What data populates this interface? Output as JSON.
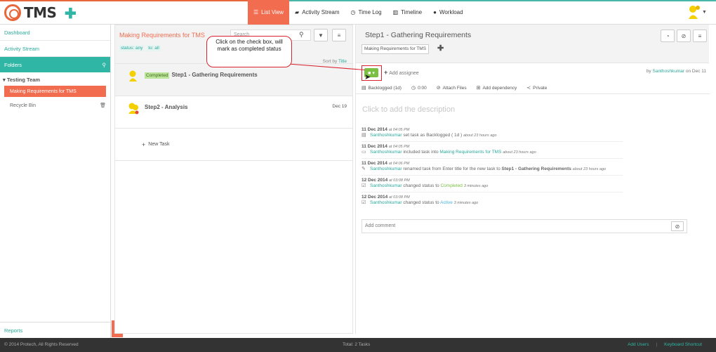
{
  "app": {
    "logo_text": "TMS"
  },
  "nav": {
    "tabs": [
      {
        "label": "List View",
        "icon": "list-icon"
      },
      {
        "label": "Activity Stream",
        "icon": "comment-icon"
      },
      {
        "label": "Time Log",
        "icon": "clock-icon"
      },
      {
        "label": "Timeline",
        "icon": "bars-icon"
      },
      {
        "label": "Workload",
        "icon": "user-icon"
      }
    ]
  },
  "sidebar": {
    "dashboard": "Dashboard",
    "activity_stream": "Activity Stream",
    "folders": "Folders",
    "team": "Testing Team",
    "active_folder": "Making Requirements for TMS",
    "recycle_bin": "Recycle Bin",
    "reports": "Reports"
  },
  "list": {
    "title": "Making Requirements for TMS",
    "filter_status": "status: any",
    "filter_to": "to: all",
    "search_placeholder": "Search",
    "sort_label": "Sort by",
    "sort_value": "Title",
    "tasks": [
      {
        "badge": "Completed",
        "name": "Step1 - Gathering Requirements",
        "date": ""
      },
      {
        "badge": "",
        "name": "Step2 - Analysis",
        "date": "Dec 19"
      }
    ],
    "new_task": "New Task"
  },
  "detail": {
    "title": "Step1 - Gathering Requirements",
    "folder_tag": "Making Requirements for TMS",
    "add_assignee": "Add assignee",
    "by_prefix": "by",
    "by_user": "Santhoshkumar",
    "by_date": "on Dec 11",
    "meta": {
      "backlogged": "Backlogged (1d)",
      "time": "0:00",
      "attach": "Attach Files",
      "dependency": "Add dependency",
      "private": "Private"
    },
    "description_placeholder": "Click to add the description",
    "timeline": [
      {
        "date": "11 Dec 2014",
        "time": "at 04:05 PM",
        "user": "Santhoshkumar",
        "text": "set task as Backlogged ( 1d )",
        "ago": "about 23 hours ago"
      },
      {
        "date": "11 Dec 2014",
        "time": "at 04:05 PM",
        "user": "Santhoshkumar",
        "text": "included task into",
        "link": "Making Requirements for TMS",
        "ago": "about 23 hours ago"
      },
      {
        "date": "11 Dec 2014",
        "time": "at 04:06 PM",
        "user": "Santhoshkumar",
        "text": "renamed task from Enter title for the new task to",
        "bold": "Step1 - Gathering Requirements",
        "ago": "about 23 hours ago"
      },
      {
        "date": "12 Dec 2014",
        "time": "at 03:08 PM",
        "user": "Santhoshkumar",
        "text": "changed status to",
        "status": "Completed",
        "ago": "3 minutes ago"
      },
      {
        "date": "12 Dec 2014",
        "time": "at 03:08 PM",
        "user": "Santhoshkumar",
        "text": "changed status to",
        "status": "Active",
        "ago": "3 minutes ago"
      }
    ],
    "comment_placeholder": "Add comment"
  },
  "callout": {
    "text": "Click on the check box, will mark as completed status"
  },
  "footer": {
    "copyright": "© 2014 Protech, All Rights Reserved",
    "total": "Total: 2 Tasks",
    "add_users": "Add Users",
    "separator": "|",
    "shortcut": "Keyboard Shortcut"
  },
  "colors": {
    "accent_orange": "#f26c4f",
    "accent_teal": "#2fb6a5",
    "completed_green": "#7bc043",
    "callout_red": "#d9232f"
  }
}
